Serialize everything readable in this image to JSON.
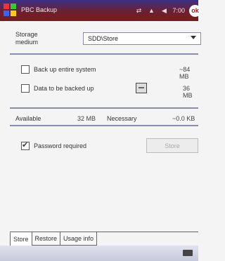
{
  "title": "PBC Backup",
  "tray": {
    "time": "7:00",
    "ok_label": "ok"
  },
  "storage": {
    "label_line1": "Storage",
    "label_line2": "medium",
    "selected": "SDD\\Store"
  },
  "options": {
    "entire": {
      "label": "Back up entire system",
      "value": "~84 MB"
    },
    "data": {
      "label": "Data to be backed up",
      "value": "36 MB"
    }
  },
  "space": {
    "available_label": "Available",
    "available_value": "32 MB",
    "necessary_label": "Necessary",
    "necessary_value": "~0.0 KB"
  },
  "password": {
    "label": "Password required",
    "button": "Store"
  },
  "tabs": [
    "Store",
    "Restore",
    "Usage info"
  ],
  "colors": {
    "titlebar_start": "#3b2f86",
    "titlebar_end": "#7a1a1a"
  }
}
